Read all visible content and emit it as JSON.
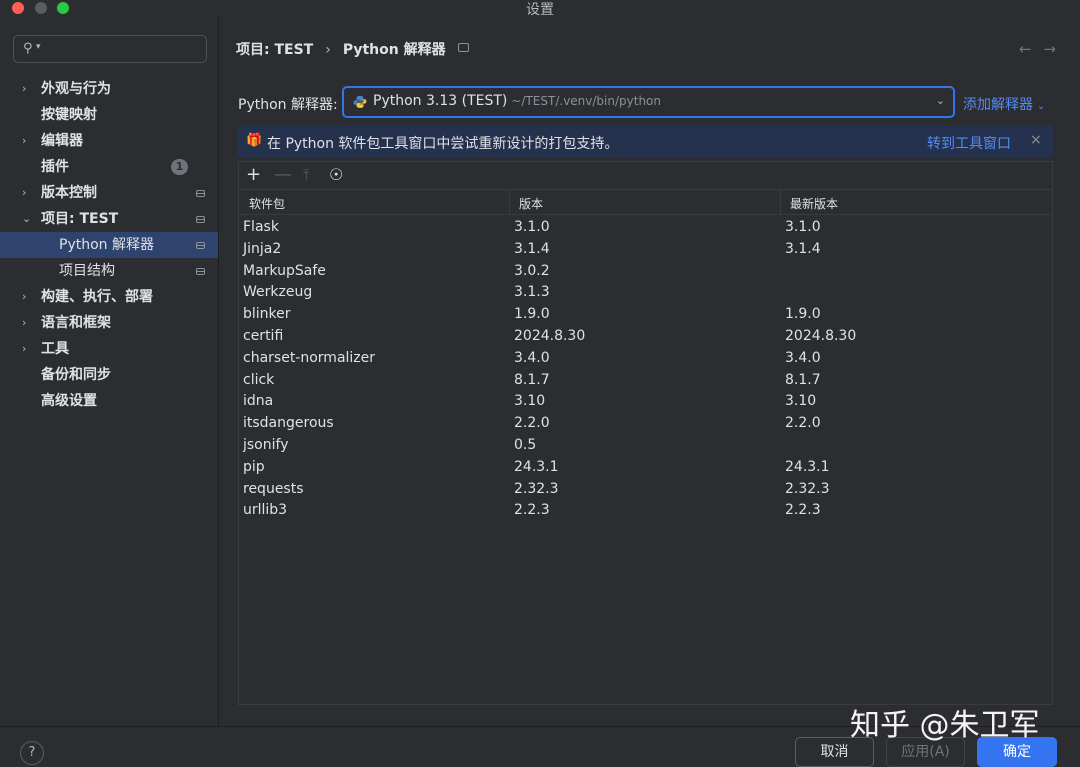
{
  "window": {
    "title": "设置"
  },
  "sidebar": {
    "items": [
      {
        "label": "外观与行为",
        "chevron": "›"
      },
      {
        "label": "按键映射"
      },
      {
        "label": "编辑器",
        "chevron": "›"
      },
      {
        "label": "插件",
        "badge": "1"
      },
      {
        "label": "版本控制",
        "chevron": "›"
      },
      {
        "label": "项目: TEST",
        "chevron": "⌄"
      },
      {
        "label": "Python 解释器"
      },
      {
        "label": "项目结构"
      },
      {
        "label": "构建、执行、部署",
        "chevron": "›"
      },
      {
        "label": "语言和框架",
        "chevron": "›"
      },
      {
        "label": "工具",
        "chevron": "›"
      },
      {
        "label": "备份和同步"
      },
      {
        "label": "高级设置"
      }
    ]
  },
  "breadcrumb": {
    "parent": "项目: TEST",
    "current": "Python 解释器",
    "sep": "›"
  },
  "interpreter": {
    "label": "Python 解释器:",
    "name": "Python 3.13 (TEST)",
    "path": "~/TEST/.venv/bin/python",
    "add_label": "添加解释器"
  },
  "banner": {
    "text": "在 Python 软件包工具窗口中尝试重新设计的打包支持。",
    "link": "转到工具窗口",
    "close": "×"
  },
  "table": {
    "headers": [
      "软件包",
      "版本",
      "最新版本"
    ],
    "rows": [
      [
        "Flask",
        "3.1.0",
        "3.1.0"
      ],
      [
        "Jinja2",
        "3.1.4",
        "3.1.4"
      ],
      [
        "MarkupSafe",
        "3.0.2",
        ""
      ],
      [
        "Werkzeug",
        "3.1.3",
        ""
      ],
      [
        "blinker",
        "1.9.0",
        "1.9.0"
      ],
      [
        "certifi",
        "2024.8.30",
        "2024.8.30"
      ],
      [
        "charset-normalizer",
        "3.4.0",
        "3.4.0"
      ],
      [
        "click",
        "8.1.7",
        "8.1.7"
      ],
      [
        "idna",
        "3.10",
        "3.10"
      ],
      [
        "itsdangerous",
        "2.2.0",
        "2.2.0"
      ],
      [
        "jsonify",
        "0.5",
        ""
      ],
      [
        "pip",
        "24.3.1",
        "24.3.1"
      ],
      [
        "requests",
        "2.32.3",
        "2.32.3"
      ],
      [
        "urllib3",
        "2.2.3",
        "2.2.3"
      ]
    ]
  },
  "footer": {
    "help": "?",
    "cancel": "取消",
    "apply": "应用(A)",
    "ok": "确定"
  },
  "watermark": "知乎 @朱卫军",
  "colors": {
    "accent": "#3574f0",
    "link": "#548af7",
    "selection": "#2e436e",
    "background": "#2b2d30"
  }
}
